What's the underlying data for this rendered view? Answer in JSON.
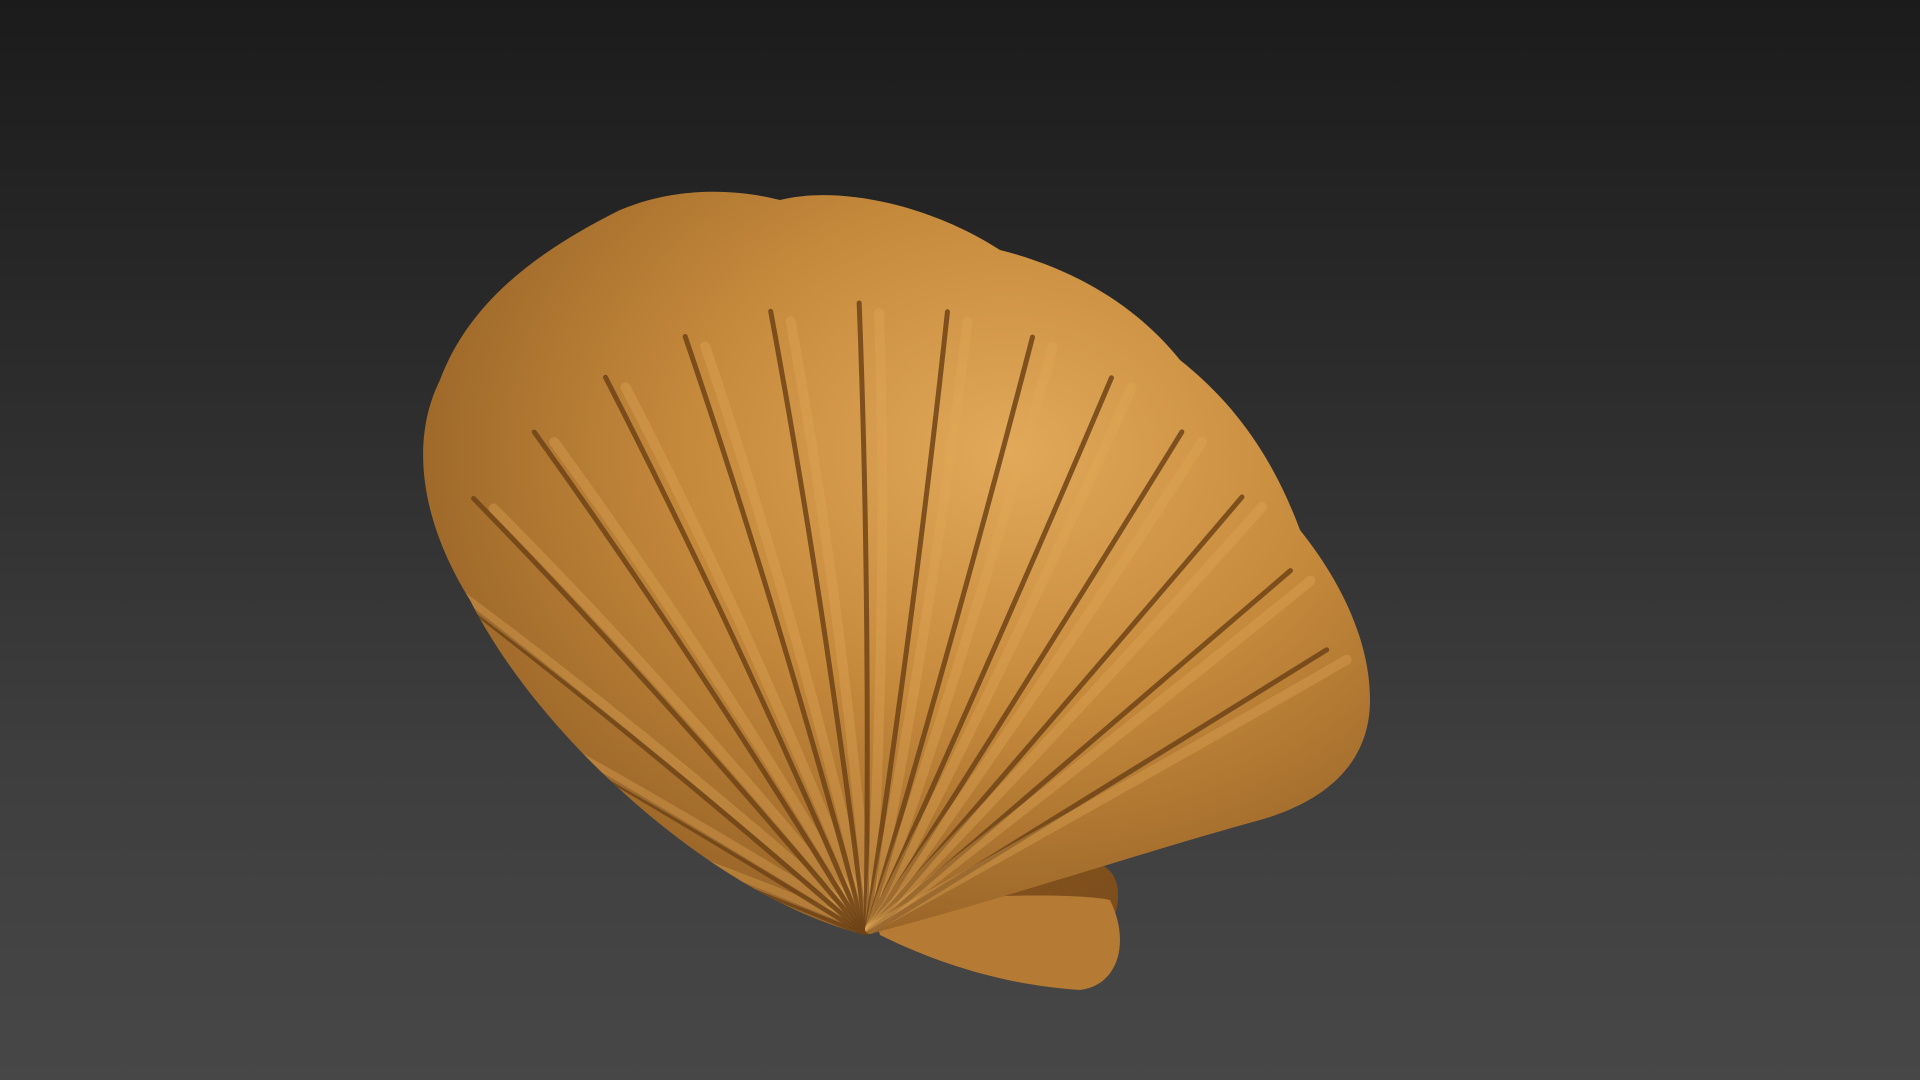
{
  "scene": {
    "object": "scallop-shell",
    "background_top": "#1b1b1b",
    "background_bottom": "#474747",
    "material_color": "#c68a3c",
    "material_highlight": "#e2a95a",
    "material_shadow": "#6e4316",
    "rib_count": 15
  }
}
